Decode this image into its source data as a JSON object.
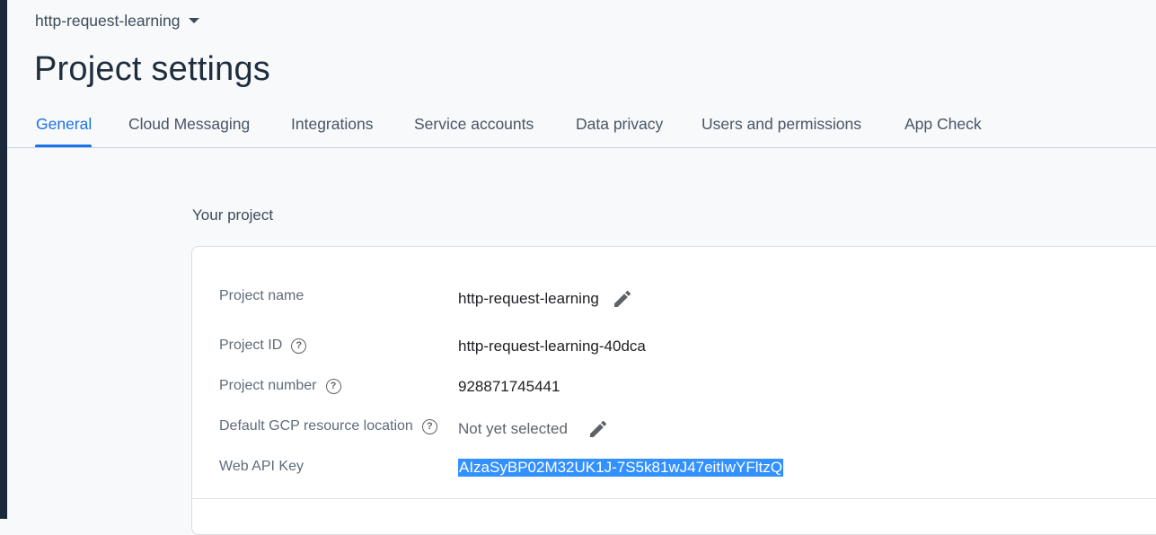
{
  "header": {
    "project_switcher": "http-request-learning",
    "page_title": "Project settings"
  },
  "tabs": [
    {
      "label": "General",
      "active": true
    },
    {
      "label": "Cloud Messaging",
      "active": false
    },
    {
      "label": "Integrations",
      "active": false
    },
    {
      "label": "Service accounts",
      "active": false
    },
    {
      "label": "Data privacy",
      "active": false
    },
    {
      "label": "Users and permissions",
      "active": false
    },
    {
      "label": "App Check",
      "active": false
    }
  ],
  "your_project": {
    "section_title": "Your project",
    "rows": [
      {
        "label": "Project name",
        "value": "http-request-learning",
        "help": false,
        "editable": true
      },
      {
        "label": "Project ID",
        "value": "http-request-learning-40dca",
        "help": true,
        "editable": false
      },
      {
        "label": "Project number",
        "value": "928871745441",
        "help": true,
        "editable": false
      },
      {
        "label": "Default GCP resource location",
        "value": "Not yet selected",
        "help": true,
        "editable": true
      },
      {
        "label": "Web API Key",
        "value": "AIzaSyBP02M32UK1J-7S5k81wJ47eitIwYFltzQ",
        "help": false,
        "editable": false,
        "selected": true
      }
    ]
  },
  "icons": {
    "caret": "chevron-down-icon",
    "help": "help-circle-icon",
    "edit": "pencil-icon"
  },
  "colors": {
    "accent": "#1a73e8",
    "selection": "#3390ff",
    "title": "#1f2e3e"
  }
}
